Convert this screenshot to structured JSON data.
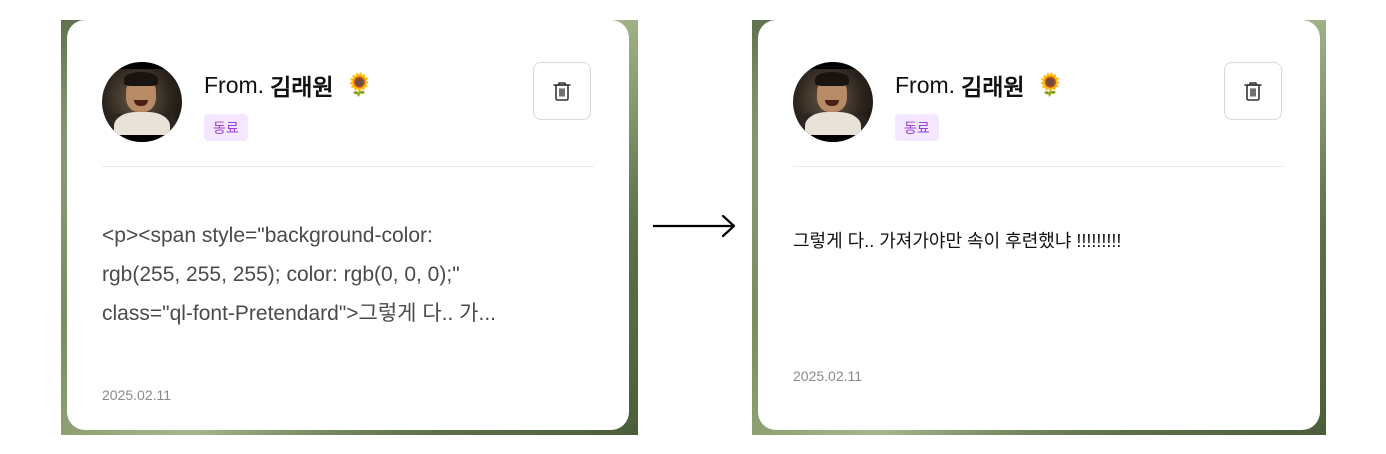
{
  "before": {
    "from_prefix": "From.",
    "sender_name": "김래원",
    "sender_emoji": "🌻",
    "relation_badge": "동료",
    "message_text": "<p><span style=\"background-color:\nrgb(255, 255, 255); color: rgb(0, 0, 0);\"\nclass=\"ql-font-Pretendard\">그렇게 다.. 가...",
    "date": "2025.02.11",
    "delete_icon": "trash-icon"
  },
  "after": {
    "from_prefix": "From.",
    "sender_name": "김래원",
    "sender_emoji": "🌻",
    "relation_badge": "동료",
    "message_text": "그렇게 다.. 가져가야만 속이 후련했냐 !!!!!!!!!",
    "date": "2025.02.11",
    "delete_icon": "trash-icon"
  },
  "colors": {
    "badge_bg": "#f3e8ff",
    "badge_text": "#9b3fd6",
    "card_bg": "#ffffff"
  }
}
